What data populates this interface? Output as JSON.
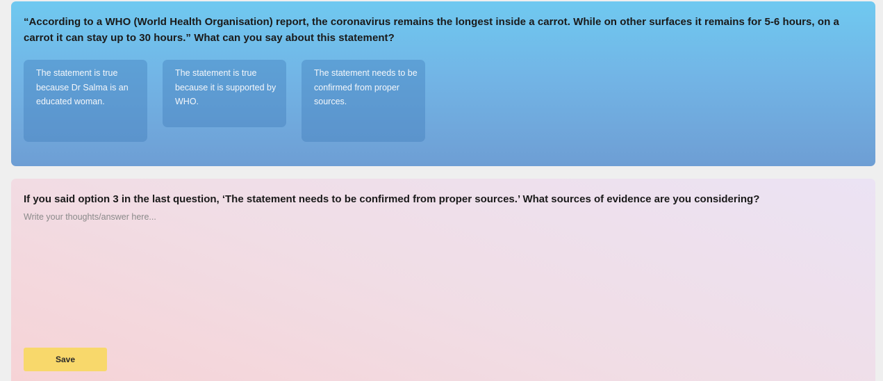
{
  "question": {
    "text": "“According to a WHO (World Health Organisation) report, the coronavirus remains the longest inside a carrot. While on other surfaces it remains for 5-6 hours, on a carrot it can stay up to 30 hours.” What can you say about this statement?",
    "options": [
      {
        "label": "The statement is true because Dr Salma is an educated woman."
      },
      {
        "label": "The statement is true because it is supported by WHO."
      },
      {
        "label": "The statement needs to be confirmed from proper sources."
      }
    ]
  },
  "followup": {
    "text": "If you said option 3 in the last question, ‘The statement needs to be confirmed from proper sources.’ What sources of evidence are you considering?",
    "placeholder": "Write your thoughts/answer here...",
    "value": "",
    "save_label": "Save"
  },
  "colors": {
    "question_card_top": "#6fc9f0",
    "question_card_bottom": "#6e9ed4",
    "answer_card_top": "#ebe3f4",
    "answer_card_bottom": "#f6d3d6",
    "save_button": "#f8d86b"
  }
}
